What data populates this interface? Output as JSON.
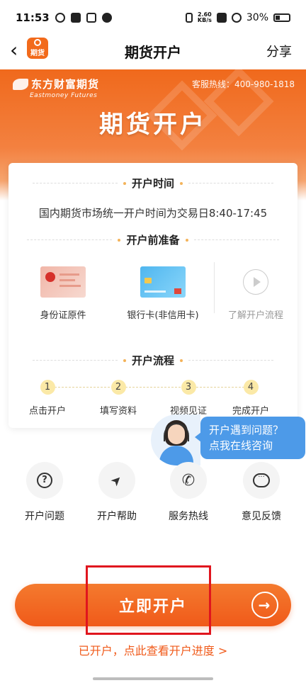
{
  "status_bar": {
    "time": "11:53",
    "net_speed_value": "2.60",
    "net_speed_unit": "KB/s",
    "battery": "30%"
  },
  "nav": {
    "title": "期货开户",
    "share": "分享",
    "app_logo_text": "期货"
  },
  "banner": {
    "brand_cn": "东方财富期货",
    "brand_en": "Eastmoney Futures",
    "hotline": "客服热线：400-980-1818",
    "title": "期货开户"
  },
  "card": {
    "open_time": {
      "heading": "开户时间",
      "text": "国内期货市场统一开户时间为交易日8:40-17:45"
    },
    "preparation": {
      "heading": "开户前准备",
      "items": [
        {
          "label": "身份证原件",
          "icon": "id-card-icon"
        },
        {
          "label": "银行卡(非信用卡)",
          "icon": "bank-card-icon"
        },
        {
          "label": "了解开户流程",
          "icon": "play-icon"
        }
      ]
    },
    "process": {
      "heading": "开户流程",
      "steps": [
        {
          "num": "1",
          "label": "点击开户"
        },
        {
          "num": "2",
          "label": "填写资料"
        },
        {
          "num": "3",
          "label": "视频见证"
        },
        {
          "num": "4",
          "label": "完成开户"
        }
      ]
    }
  },
  "chat": {
    "line1": "开户遇到问题？",
    "line2": "点我在线咨询"
  },
  "services": [
    {
      "label": "开户问题",
      "icon": "question-icon",
      "glyph": "?"
    },
    {
      "label": "开户帮助",
      "icon": "navigation-arrow-icon",
      "glyph": "➤"
    },
    {
      "label": "服务热线",
      "icon": "phone-icon",
      "glyph": "✆"
    },
    {
      "label": "意见反馈",
      "icon": "chat-bubble-icon",
      "glyph": "···"
    }
  ],
  "cta": {
    "label": "立即开户",
    "arrow": "→"
  },
  "progress_link": "已开户，点此查看开户进度 >",
  "colors": {
    "accent": "#f05a1a",
    "highlight": "#e0151e",
    "chat": "#4d9ae8",
    "step": "#fbe9a7"
  }
}
